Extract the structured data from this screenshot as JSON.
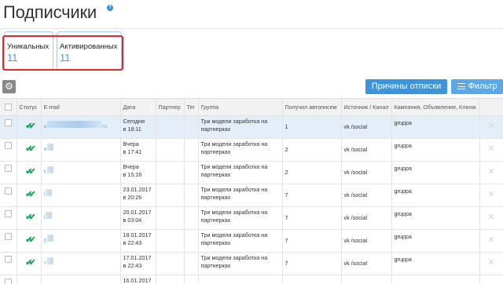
{
  "header": {
    "title": "Подписчики",
    "help_icon": "?"
  },
  "stats": [
    {
      "label": "Уникальных",
      "value": "11"
    },
    {
      "label": "Активированных",
      "value": "11"
    }
  ],
  "toolbar": {
    "settings_icon": "⚙",
    "reasons_label": "Причины отписки",
    "filter_label": "Фильтр"
  },
  "table": {
    "columns": [
      "Статус",
      "E-mail",
      "Дата",
      "Партнер",
      "Тег",
      "Группа",
      "Получил автописем",
      "Источник / Канал",
      "Кампания, Объявление, Ключи"
    ],
    "rows": [
      {
        "email_start": "a",
        "email_end": "ru",
        "date1": "Сегодня",
        "date2": "в 18:11",
        "group1": "Три модели заработка на",
        "group2": "партнерках",
        "letters": "1",
        "source": "vk /social",
        "campaign": "gruppa",
        "selected": true
      },
      {
        "email_start": "a",
        "email_end": "",
        "date1": "Вчера",
        "date2": "в 17:41",
        "group1": "Три модели заработка на",
        "group2": "партнерках",
        "letters": "2",
        "source": "vk /social",
        "campaign": "gruppa",
        "selected": false
      },
      {
        "email_start": "k",
        "email_end": "",
        "date1": "Вчера",
        "date2": "в 15:16",
        "group1": "Три модели заработка на",
        "group2": "партнерках",
        "letters": "2",
        "source": "vk /social",
        "campaign": "gruppa",
        "selected": false
      },
      {
        "email_start": "l",
        "email_end": "",
        "date1": "23.01.2017",
        "date2": "в 20:26",
        "group1": "Три модели заработка на",
        "group2": "партнерках",
        "letters": "7",
        "source": "vk /social",
        "campaign": "gruppa",
        "selected": false
      },
      {
        "email_start": "l",
        "email_end": "",
        "date1": "20.01.2017",
        "date2": "в 03:04",
        "group1": "Три модели заработка на",
        "group2": "партнерках",
        "letters": "7",
        "source": "vk /social",
        "campaign": "gruppa",
        "selected": false
      },
      {
        "email_start": "p",
        "email_end": "",
        "date1": "18.01.2017",
        "date2": "в 22:43",
        "group1": "Три модели заработка на",
        "group2": "партнерках",
        "letters": "7",
        "source": "vk /social",
        "campaign": "gruppa",
        "selected": false
      },
      {
        "email_start": "v",
        "email_end": "",
        "date1": "17.01.2017",
        "date2": "в 22:43",
        "group1": "Три модели заработка на",
        "group2": "партнерках",
        "letters": "7",
        "source": "vk /social",
        "campaign": "gruppa",
        "selected": false
      },
      {
        "email_start": "",
        "email_end": "",
        "date1": "16.01.2017",
        "date2": "",
        "group1": "",
        "group2": "",
        "letters": "",
        "source": "",
        "campaign": "",
        "selected": false
      }
    ]
  },
  "colors": {
    "accent": "#3c94dc",
    "highlight_border": "#e02a2a",
    "status_ok": "#1aa65c",
    "selected_row": "#e4eef8"
  }
}
